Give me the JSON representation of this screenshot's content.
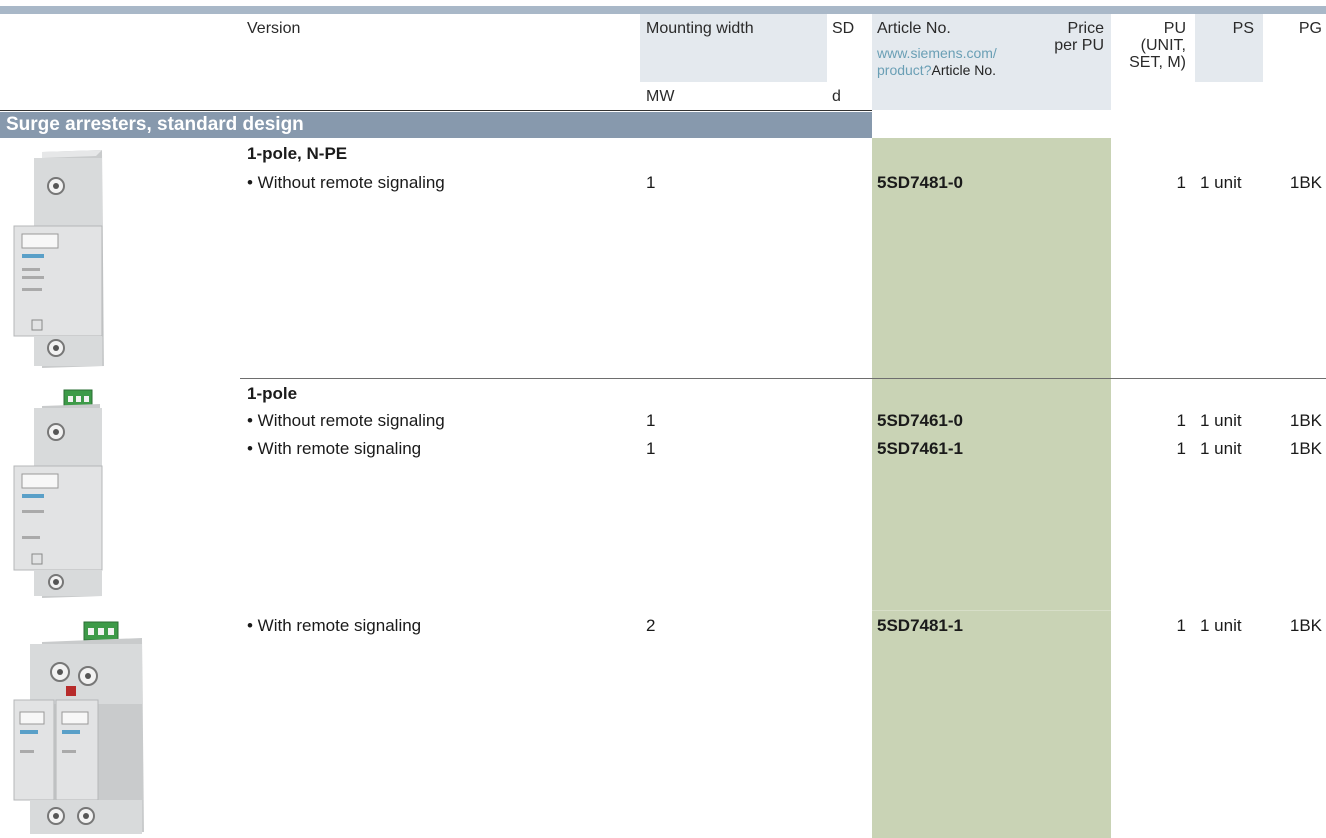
{
  "header": {
    "version": "Version",
    "mounting_width": "Mounting width",
    "sd": "SD",
    "article_no": "Article No.",
    "article_link_1": "www.siemens.com/",
    "article_link_2": "product?",
    "article_link_suffix": "Article No.",
    "price_1": "Price",
    "price_2": "per PU",
    "pu_1": "PU",
    "pu_2": "(UNIT,",
    "pu_3": "SET, M)",
    "ps": "PS",
    "pg": "PG",
    "mw": "MW",
    "d": "d"
  },
  "section_title": "Surge arresters, standard design",
  "groups": [
    {
      "title": "1-pole, N-PE",
      "rows": [
        {
          "version": "• Without remote signaling",
          "mw": "1",
          "article": "5SD7481-0",
          "pu": "1",
          "ps": "1 unit",
          "pg": "1BK"
        }
      ]
    },
    {
      "title": "1-pole",
      "rows": [
        {
          "version": "• Without remote signaling",
          "mw": "1",
          "article": "5SD7461-0",
          "pu": "1",
          "ps": "1 unit",
          "pg": "1BK"
        },
        {
          "version": "• With remote signaling",
          "mw": "1",
          "article": "5SD7461-1",
          "pu": "1",
          "ps": "1 unit",
          "pg": "1BK"
        }
      ]
    },
    {
      "title": "",
      "rows": [
        {
          "version": "• With remote signaling",
          "mw": "2",
          "article": "5SD7481-1",
          "pu": "1",
          "ps": "1 unit",
          "pg": "1BK"
        }
      ]
    }
  ],
  "icons": [
    "surge-arrester-1pole-npe-image",
    "surge-arrester-1pole-image",
    "surge-arrester-2module-image"
  ]
}
